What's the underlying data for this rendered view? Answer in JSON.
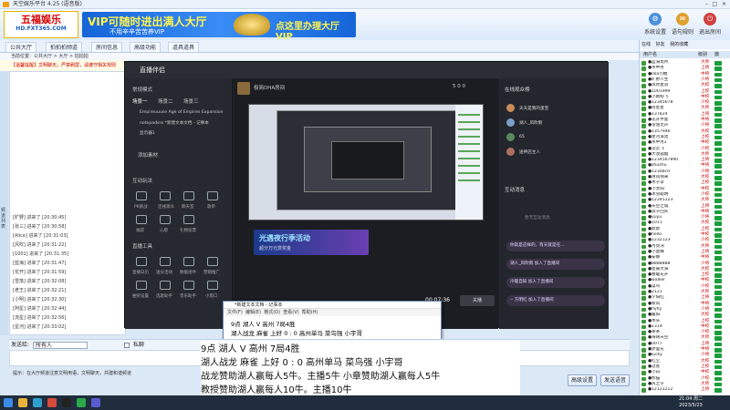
{
  "window": {
    "title": "天空娱乐平台 4.25 (语音版)",
    "controls": [
      "min",
      "max",
      "close"
    ]
  },
  "banner": {
    "logo_main": "五福娱乐",
    "logo_sub": "HD.FXT365.COM",
    "ad_main": "VIP可随时进出满人大厅",
    "ad_sub": "不用辛辛苦苦养VIP",
    "ad_right": "点这里办理大厅VIP",
    "buttons": [
      {
        "label": "系统设置",
        "icon": "gear-icon"
      },
      {
        "label": "语句规则",
        "icon": "chat-icon"
      },
      {
        "label": "帮助",
        "icon": "help-icon"
      },
      {
        "label": "退出房间",
        "icon": "exit-icon"
      }
    ]
  },
  "tabs": [
    "公共大厅",
    "拍拍拍频道",
    "房间信息",
    "高级功能",
    "道具道具"
  ],
  "breadcrumb": "当前位置：公共大厅 > 大厅 > 拍拍拍",
  "announce": "【温馨提醒】文明聊天，严禁刷屏，请遵守相关规则",
  "side_tab": "频道列表",
  "chat_lines": [
    "[旷野] 进来了 [20:30:45]",
    "[张三] 进来了 [20:30:58]",
    "[Alice] 进来了 [20:31:03]",
    "[风吹] 进来了 [20:31:22]",
    "[1001] 进来了 [20:31:35]",
    "[蓝海] 进来了 [20:31:47]",
    "[花开] 进来了 [20:31:59]",
    "[雪落] 进来了 [20:32:08]",
    "[老王] 进来了 [20:32:21]",
    "[小明] 进来了 [20:32:30]",
    "[阿星] 进来了 [20:32:44]",
    "[流星] 进来了 [20:32:56]",
    "[星河] 进来了 [20:33:02]",
    "[小雨] 进来了 [20:33:17]"
  ],
  "input": {
    "label": "发送给:",
    "target": "所有人",
    "checkbox": "私聊"
  },
  "tip": "提示：在大厅频道注意文明用语，文明聊天，共建和谐频道",
  "bottom_buttons": [
    "高级设置",
    "发送语音"
  ],
  "rightpane": {
    "tabs": [
      "在线",
      "好友",
      "我的收藏"
    ],
    "headers": [
      "用户名",
      "级别",
      "旗"
    ],
    "users": [
      "●蓝海龙吟",
      "●水中月",
      "●lala小糖",
      "●旷野人生",
      "●风吹麦浪",
      "●1001999",
      "●小雨纷飞",
      "●12345678",
      "●阿星星",
      "●137824",
      "●花开半夏",
      "●雪落无声",
      "●1357946",
      "●星河滚烫",
      "●水中月2",
      "●流云飞",
      "●大漠孤烟",
      "●1234567890",
      "●zhuzhu",
      "●123abcd",
      "●清风徐来",
      "●木子李",
      "●小太阳",
      "●冰雪聪明",
      "●12345123",
      "●天空之城",
      "●浪子回头",
      "●yuyu",
      "●1011",
      "●默默",
      "●hello",
      "●1232123",
      "●月亮湾",
      "●小蜜蜂",
      "●安静",
      "●8888888",
      "●星辰大海",
      "●春暖花开",
      "●walker",
      "●菜鸟",
      "●2121",
      "●夕阳红",
      "●秋风",
      "●flyfly",
      "●暖阳",
      "●木头",
      "●1314",
      "●茶茶",
      "●海阔天空",
      "●0077",
      "●梦里花",
      "●lucky",
      "●红尘",
      "●过客",
      "●小白",
      "●熊猫",
      "●风之子",
      "●12121212"
    ],
    "level_labels": [
      "大师",
      "上将",
      "中将",
      "少将",
      "大校",
      "上校",
      "中校",
      "少校"
    ]
  },
  "stream_app": {
    "title": "直播伴侣",
    "scene_mode": "常规模式",
    "scene_tabs": [
      "场景一",
      "场景二",
      "场景三"
    ],
    "sources": [
      "Empireuuuse Age of Empires Expansion",
      "notepadsss *新建文本文档 - 记事本",
      "显示器1"
    ],
    "add_source": "添加素材",
    "section_interact": "互动玩法",
    "interact_items": [
      "PK挑战",
      "连线观众",
      "聊天室",
      "歌单"
    ],
    "interact_items2": [
      "福袋",
      "心愿",
      "礼物投票"
    ],
    "section_tools": "直播工具",
    "tools": [
      "直播日历",
      "送分活动",
      "数据组件",
      "营销推广"
    ],
    "tools2": [
      "抽奖设置",
      "选歌助手",
      "音乐助手",
      "小窗口"
    ],
    "room_name": "极简DHA房间",
    "room_stats": "5  0  0",
    "promo_title": "光遇夜行季活动",
    "promo_sub": "超分万元赏奖金",
    "timer": "00:07:36",
    "live_btn": "关播",
    "right_title": "在线观众榜",
    "viewers": [
      "天天是我的蛋宝",
      "湖人_风吹雨",
      "65",
      "送神店主人"
    ],
    "interact_title": "互动消息",
    "interact_hint": "暂无互动消息",
    "messages": [
      "你就是这样的，有天就是在...",
      "湖人_风吹雨 加入了直播间",
      "冷暖自知 加入了直播间",
      "-- 方明红 加入了直播间"
    ]
  },
  "notepad": {
    "title": "*新建文本文档 - 记事本",
    "menu": [
      "文件(F)",
      "编辑(E)",
      "格式(O)",
      "查看(V)",
      "帮助(H)"
    ],
    "lines": [
      "9点                  湖人 V 高州           7局4胜",
      "湖人战龙  麻雀  上好  0  :  0    高州单马  菜鸟强  小宇哥"
    ]
  },
  "overlay": {
    "lines": [
      "9点                     湖人 V 高州              7局4胜",
      "湖人战龙  麻雀  上好  0  :  0    高州单马 菜鸟强  小宇哥",
      "战龙赞助湖人赢每人5牛。主播5牛    小章赞助湖人赢每人5牛",
      "教授赞助湖人赢每人10牛。主播10牛"
    ]
  },
  "taskbar": {
    "time": "21:04  周二",
    "date": "2023/5/23"
  }
}
